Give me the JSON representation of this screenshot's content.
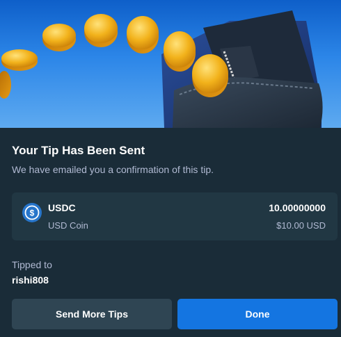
{
  "modal": {
    "title": "Your Tip Has Been Sent",
    "subtitle": "We have emailed you a confirmation of this tip."
  },
  "hero": {
    "illustration": "coins-flying-into-wallet"
  },
  "coin": {
    "icon": "usdc-icon",
    "symbol": "USDC",
    "name": "USD Coin",
    "amount": "10.00000000",
    "fiat": "$10.00 USD"
  },
  "recipient": {
    "label": "Tipped to",
    "username": "rishi808"
  },
  "actions": {
    "send_more_label": "Send More Tips",
    "done_label": "Done"
  },
  "colors": {
    "background": "#1a2c38",
    "card": "#213743",
    "secondary_button": "#2f4553",
    "primary_button": "#1475e1",
    "muted_text": "#b1bad3",
    "usdc": "#2775ca"
  }
}
